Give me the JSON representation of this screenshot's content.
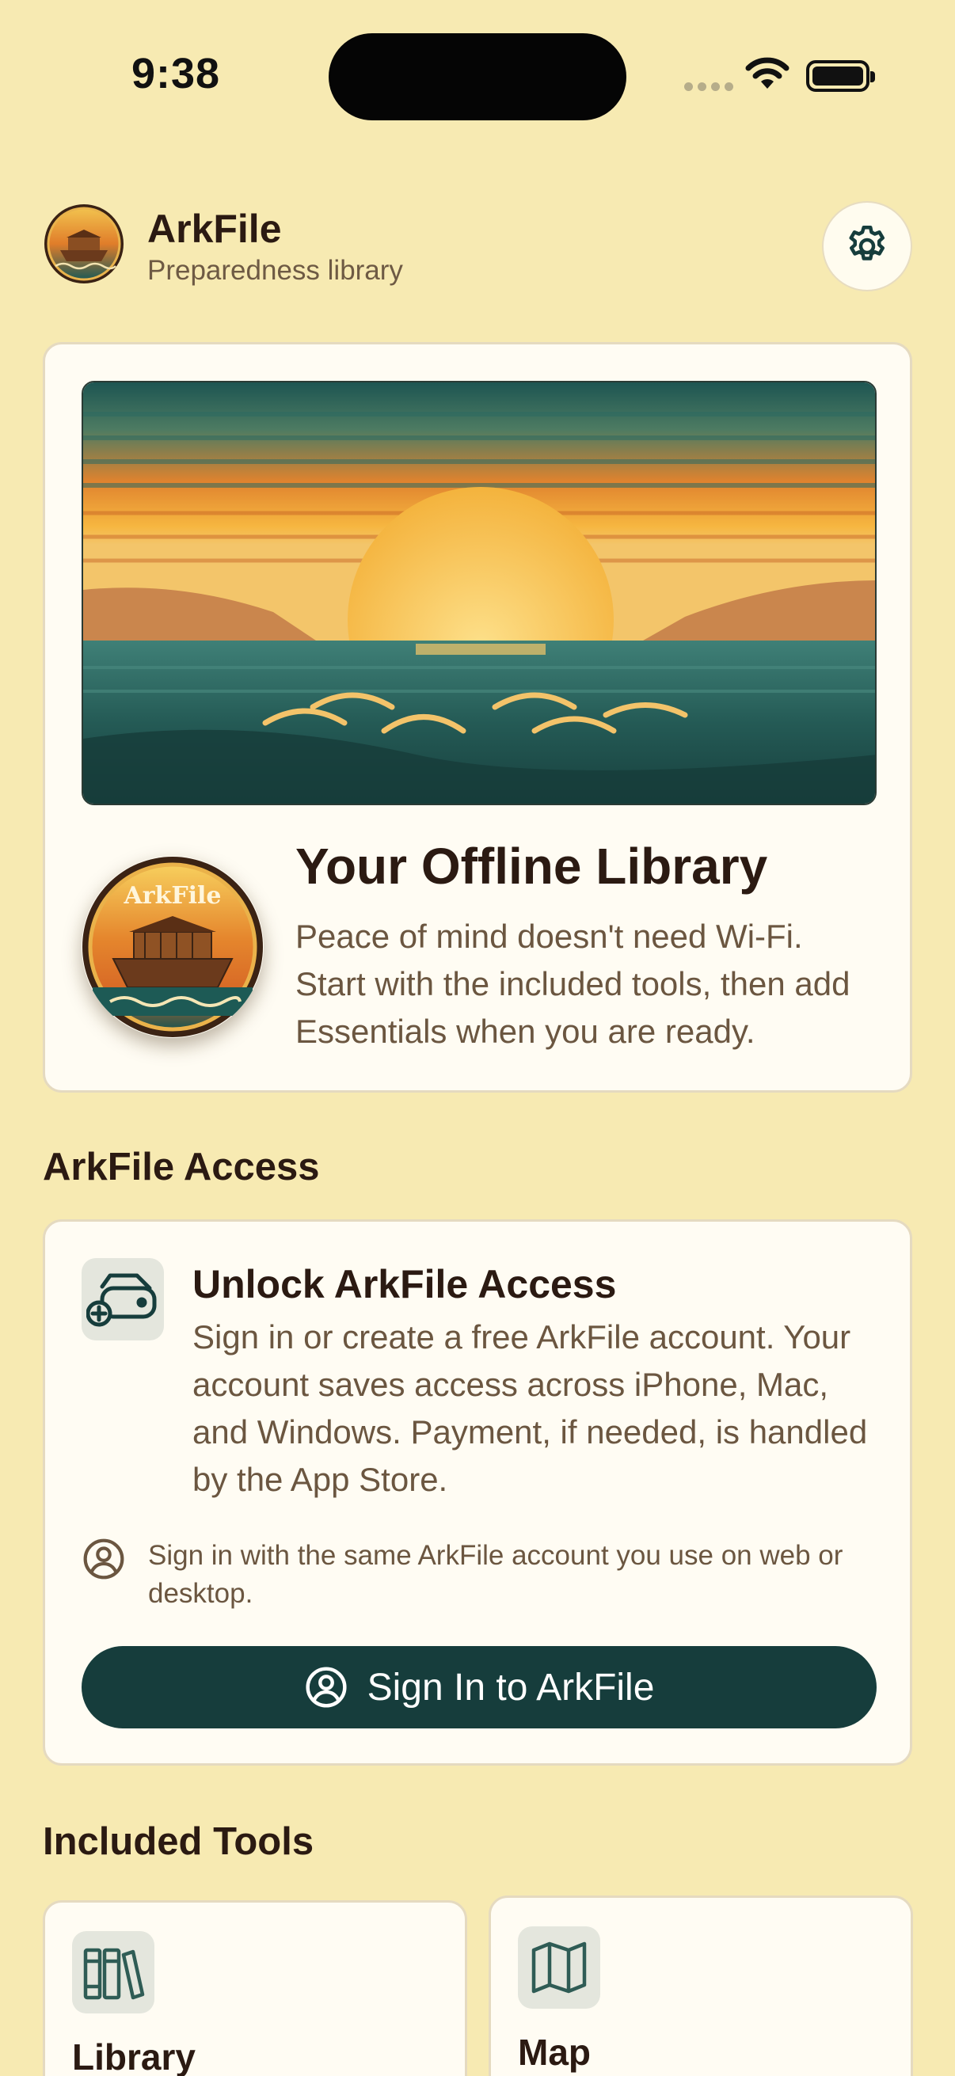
{
  "status_bar": {
    "time": "9:38"
  },
  "header": {
    "title": "ArkFile",
    "subtitle": "Preparedness library",
    "logo_text": "ArkFile"
  },
  "hero": {
    "title": "Your Offline Library",
    "body": "Peace of mind doesn't need Wi-Fi. Start with the included tools, then add Essentials when you are ready.",
    "badge_text": "ArkFile"
  },
  "access_section": {
    "heading": "ArkFile Access",
    "card_title": "Unlock ArkFile Access",
    "card_body": "Sign in or create a free ArkFile account. Your account saves access across iPhone, Mac, and Windows. Payment, if needed, is handled by the App Store.",
    "note": "Sign in with the same ArkFile account you use on web or desktop.",
    "button_label": "Sign In to ArkFile"
  },
  "tools_section": {
    "heading": "Included Tools",
    "tools": [
      {
        "label": "Library",
        "icon": "books-icon"
      },
      {
        "label": "Map",
        "icon": "map-icon"
      }
    ]
  },
  "colors": {
    "background": "#f7eab2",
    "card": "#fffcf3",
    "primary_button": "#163d3c",
    "heading_text": "#2b1a12",
    "body_text": "#6b5640"
  }
}
